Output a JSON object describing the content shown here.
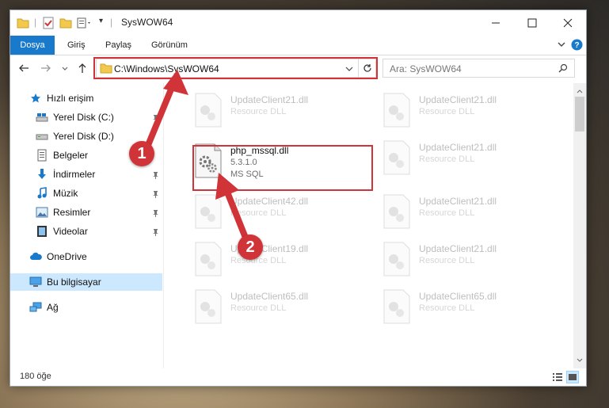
{
  "window": {
    "title": "SysWOW64"
  },
  "ribbon": {
    "tabs": [
      "Dosya",
      "Giriş",
      "Paylaş",
      "Görünüm"
    ]
  },
  "address": {
    "path": "C:\\Windows\\SysWOW64",
    "search_placeholder": "Ara: SysWOW64"
  },
  "sidebar": {
    "items": [
      {
        "label": "Hızlı erişim"
      },
      {
        "label": "Yerel Disk (C:)"
      },
      {
        "label": "Yerel Disk (D:)"
      },
      {
        "label": "Belgeler"
      },
      {
        "label": "İndirmeler"
      },
      {
        "label": "Müzik"
      },
      {
        "label": "Resimler"
      },
      {
        "label": "Videolar"
      },
      {
        "label": "OneDrive"
      },
      {
        "label": "Bu bilgisayar"
      },
      {
        "label": "Ağ"
      }
    ]
  },
  "files": {
    "highlighted": {
      "name": "php_mssql.dll",
      "version": "5.3.1.0",
      "description": "MS SQL"
    },
    "background": [
      {
        "name": "UpdateClient21.dll",
        "description": "Resource DLL"
      },
      {
        "name": "UpdateClient21.dll",
        "description": "Resource DLL"
      },
      {
        "name": "UpdateClient21.dll",
        "description": "Resource DLL"
      },
      {
        "name": "UpdateClient42.dll",
        "description": "Resource DLL"
      },
      {
        "name": "UpdateClient21.dll",
        "description": "Resource DLL"
      },
      {
        "name": "UpdateClient19.dll",
        "description": "Resource DLL"
      },
      {
        "name": "UpdateClient21.dll",
        "description": "Resource DLL"
      },
      {
        "name": "UpdateClient65.dll",
        "description": "Resource DLL"
      },
      {
        "name": "UpdateClient65.dll",
        "description": "Resource DLL"
      }
    ]
  },
  "status": {
    "count": "180 öğe"
  },
  "callouts": {
    "one": "1",
    "two": "2"
  },
  "colors": {
    "accent": "#1979ca",
    "highlight": "#d13438",
    "selection": "#cce8ff"
  }
}
